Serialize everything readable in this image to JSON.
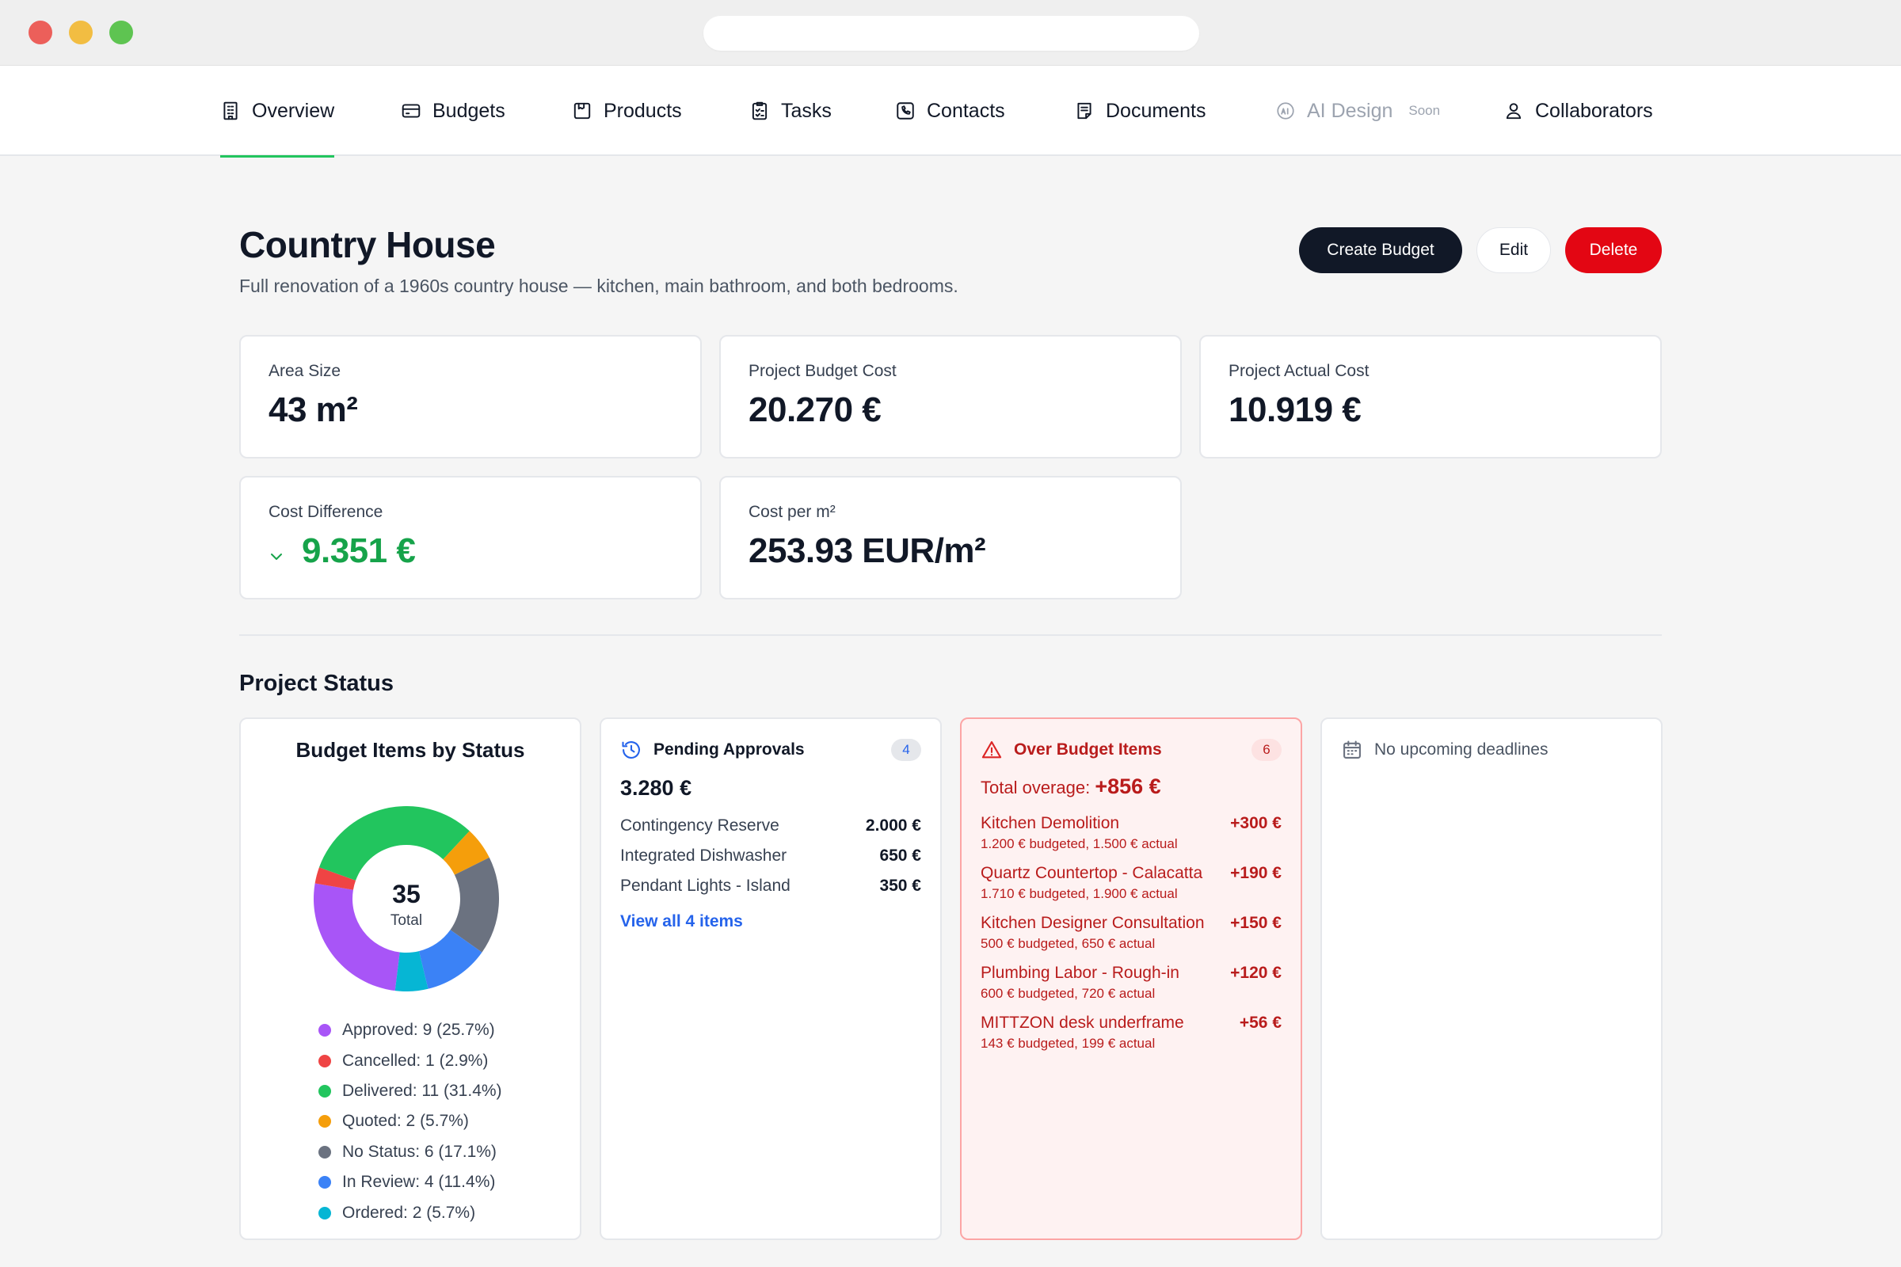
{
  "nav": {
    "items": [
      {
        "label": "Overview",
        "icon": "building-icon"
      },
      {
        "label": "Budgets",
        "icon": "wallet-icon"
      },
      {
        "label": "Products",
        "icon": "box-icon"
      },
      {
        "label": "Tasks",
        "icon": "clipboard-icon"
      },
      {
        "label": "Contacts",
        "icon": "phone-icon"
      },
      {
        "label": "Documents",
        "icon": "document-icon"
      },
      {
        "label": "AI Design",
        "icon": "ai-icon",
        "badge": "Soon"
      },
      {
        "label": "Collaborators",
        "icon": "user-icon"
      }
    ],
    "active_index": 0,
    "accent": "#22c55e"
  },
  "project": {
    "title": "Country House",
    "description": "Full renovation of a 1960s country house — kitchen, main bathroom, and both bedrooms."
  },
  "actions": {
    "create_budget": "Create Budget",
    "edit": "Edit",
    "delete": "Delete"
  },
  "stats": {
    "area": {
      "label": "Area Size",
      "value": "43 m²"
    },
    "budget_cost": {
      "label": "Project Budget Cost",
      "value": "20.270 €"
    },
    "actual_cost": {
      "label": "Project Actual Cost",
      "value": "10.919 €"
    },
    "difference": {
      "label": "Cost Difference",
      "value": "9.351 €",
      "color": "#16a34a"
    },
    "cost_per_m2": {
      "label": "Cost per m²",
      "value": "253.93 EUR/m²"
    }
  },
  "status": {
    "section_title": "Project Status",
    "donut": {
      "title": "Budget Items by Status",
      "total": "35",
      "total_label": "Total",
      "segments": [
        {
          "label": "Approved: 9 (25.7%)",
          "value": 9,
          "color": "#a855f7"
        },
        {
          "label": "Cancelled: 1 (2.9%)",
          "value": 1,
          "color": "#ef4444"
        },
        {
          "label": "Delivered: 11 (31.4%)",
          "value": 11,
          "color": "#22c55e"
        },
        {
          "label": "Quoted: 2 (5.7%)",
          "value": 2,
          "color": "#f59e0b"
        },
        {
          "label": "No Status: 6 (17.1%)",
          "value": 6,
          "color": "#6b7280"
        },
        {
          "label": "In Review: 4 (11.4%)",
          "value": 4,
          "color": "#3b82f6"
        },
        {
          "label": "Ordered: 2 (5.7%)",
          "value": 2,
          "color": "#06b6d4"
        }
      ]
    },
    "pending": {
      "title": "Pending Approvals",
      "count": "4",
      "total": "3.280 €",
      "items": [
        {
          "name": "Contingency Reserve",
          "amount": "2.000 €"
        },
        {
          "name": "Integrated Dishwasher",
          "amount": "650 €"
        },
        {
          "name": "Pendant Lights - Island",
          "amount": "350 €"
        }
      ],
      "view_all": "View all 4 items"
    },
    "over_budget": {
      "title": "Over Budget Items",
      "count": "6",
      "total_label": "Total overage:",
      "total_value": "+856 €",
      "items": [
        {
          "name": "Kitchen Demolition",
          "diff": "+300 €",
          "detail": "1.200 € budgeted, 1.500 € actual"
        },
        {
          "name": "Quartz Countertop - Calacatta",
          "diff": "+190 €",
          "detail": "1.710 € budgeted, 1.900 € actual"
        },
        {
          "name": "Kitchen Designer Consultation",
          "diff": "+150 €",
          "detail": "500 € budgeted, 650 € actual"
        },
        {
          "name": "Plumbing Labor - Rough-in",
          "diff": "+120 €",
          "detail": "600 € budgeted, 720 € actual"
        },
        {
          "name": "MITTZON desk underframe",
          "diff": "+56 €",
          "detail": "143 € budgeted, 199 € actual"
        }
      ]
    },
    "deadlines": {
      "text": "No upcoming deadlines"
    }
  }
}
